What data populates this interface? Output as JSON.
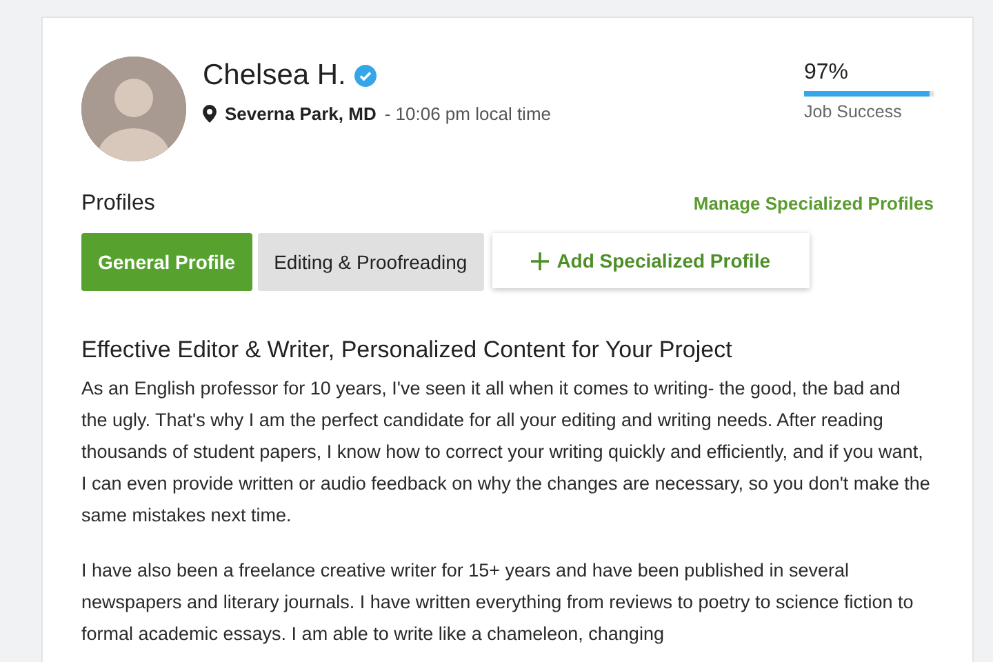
{
  "profile": {
    "name": "Chelsea H.",
    "verified": true,
    "location": "Severna Park, MD",
    "local_time": "- 10:06 pm local time"
  },
  "job_success": {
    "value": "97%",
    "level": 0.97,
    "label": "Job Success"
  },
  "profiles": {
    "title": "Profiles",
    "manage_link": "Manage Specialized Profiles",
    "tabs": [
      {
        "label": "General Profile",
        "selected": true
      },
      {
        "label": "Editing & Proofreading",
        "selected": false
      }
    ],
    "add_button": "Add Specialized Profile"
  },
  "overview": {
    "title": "Effective Editor & Writer, Personalized Content for Your Project",
    "paragraphs": [
      "As an English professor for 10 years, I've seen it all when it comes to writing- the good, the bad and the ugly. That's why I am the perfect candidate for all your editing and writing needs. After reading thousands of student papers, I know how to correct your writing quickly and efficiently, and if you want, I can even provide written or audio feedback on why the changes are necessary, so you don't make the same mistakes next time.",
      "I have also been a freelance creative writer for 15+ years and have been published in several newspapers and literary journals. I have written everything from reviews to poetry to science fiction to formal academic essays. I am able to write like a chameleon, changing"
    ]
  }
}
